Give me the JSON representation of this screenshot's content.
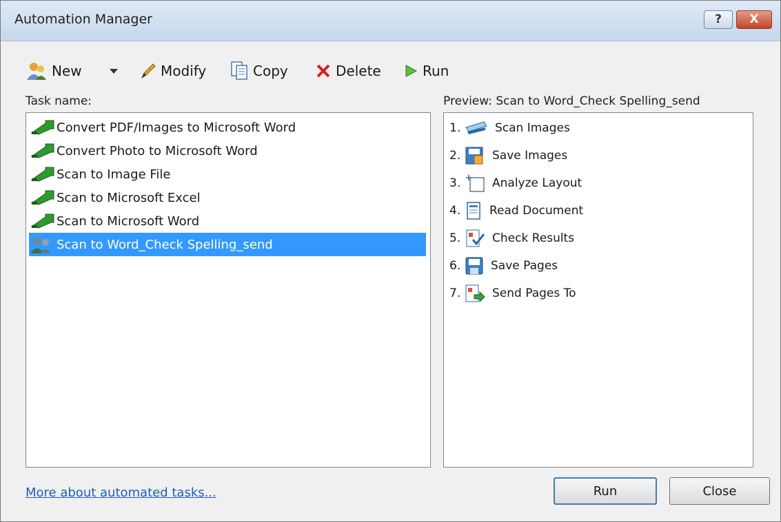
{
  "window": {
    "title": "Automation Manager",
    "help_label": "?",
    "close_label": "X"
  },
  "toolbar": {
    "new_label": "New",
    "modify_label": "Modify",
    "copy_label": "Copy",
    "delete_label": "Delete",
    "run_label": "Run"
  },
  "task_panel": {
    "label": "Task name:",
    "tasks": [
      "Convert PDF/Images to Microsoft Word",
      "Convert Photo to Microsoft Word",
      "Scan to Image File",
      "Scan to Microsoft Excel",
      "Scan to Microsoft Word",
      "Scan to Word_Check Spelling_send"
    ],
    "selected_index": 5
  },
  "preview_panel": {
    "label": "Preview: Scan to Word_Check Spelling_send",
    "steps": [
      {
        "num": "1.",
        "label": "Scan Images",
        "icon": "scanner-icon"
      },
      {
        "num": "2.",
        "label": "Save Images",
        "icon": "save-images-icon"
      },
      {
        "num": "3.",
        "label": "Analyze Layout",
        "icon": "analyze-layout-icon"
      },
      {
        "num": "4.",
        "label": "Read Document",
        "icon": "read-document-icon"
      },
      {
        "num": "5.",
        "label": "Check Results",
        "icon": "check-results-icon"
      },
      {
        "num": "6.",
        "label": "Save Pages",
        "icon": "save-pages-icon"
      },
      {
        "num": "7.",
        "label": "Send Pages To",
        "icon": "send-pages-icon"
      }
    ]
  },
  "footer": {
    "link_label": "More about automated tasks...",
    "run_label": "Run",
    "close_label": "Close"
  }
}
